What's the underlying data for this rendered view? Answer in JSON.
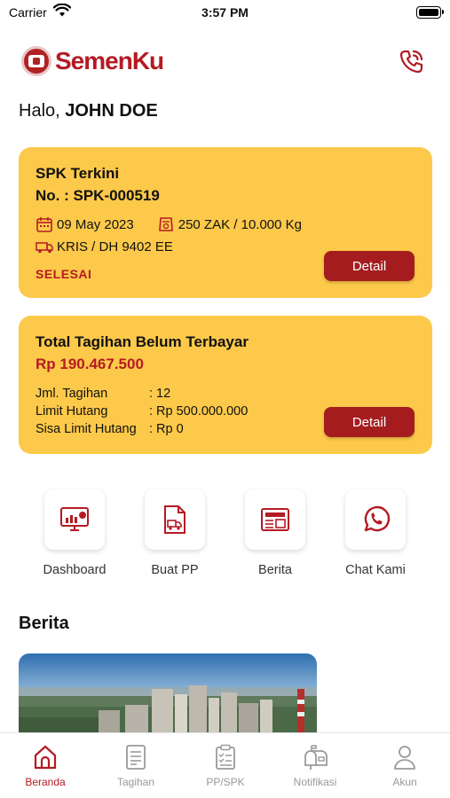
{
  "status_bar": {
    "carrier": "Carrier",
    "time": "3:57 PM"
  },
  "header": {
    "brand": "SemenKu"
  },
  "greeting": {
    "prefix": "Halo, ",
    "name": "JOHN DOE"
  },
  "spk_card": {
    "title": "SPK Terkini",
    "number": "No. : SPK-000519",
    "date": "09 May 2023",
    "quantity": "250 ZAK / 10.000 Kg",
    "vehicle": "KRIS / DH 9402 EE",
    "status": "SELESAI",
    "detail_label": "Detail"
  },
  "bill_card": {
    "title": "Total Tagihan Belum Terbayar",
    "amount": "Rp 190.467.500",
    "rows": [
      {
        "label": "Jml. Tagihan",
        "value": ": 12"
      },
      {
        "label": "Limit Hutang",
        "value": ": Rp 500.000.000"
      },
      {
        "label": "Sisa Limit Hutang",
        "value": ": Rp 0"
      }
    ],
    "detail_label": "Detail"
  },
  "shortcuts": [
    {
      "label": "Dashboard",
      "icon": "dashboard-icon"
    },
    {
      "label": "Buat PP",
      "icon": "document-truck-icon"
    },
    {
      "label": "Berita",
      "icon": "news-icon"
    },
    {
      "label": "Chat Kami",
      "icon": "whatsapp-icon"
    }
  ],
  "news": {
    "heading": "Berita"
  },
  "tabbar": {
    "active": "Beranda",
    "tabs": [
      {
        "label": "Beranda",
        "icon": "home-icon"
      },
      {
        "label": "Tagihan",
        "icon": "invoice-icon"
      },
      {
        "label": "PP/SPK",
        "icon": "clipboard-icon"
      },
      {
        "label": "Notifikasi",
        "icon": "mailbox-icon"
      },
      {
        "label": "Akun",
        "icon": "user-icon"
      }
    ]
  },
  "colors": {
    "brand_red": "#b31b24",
    "card_yellow": "#fdc94a",
    "button_red": "#a51c1f"
  }
}
